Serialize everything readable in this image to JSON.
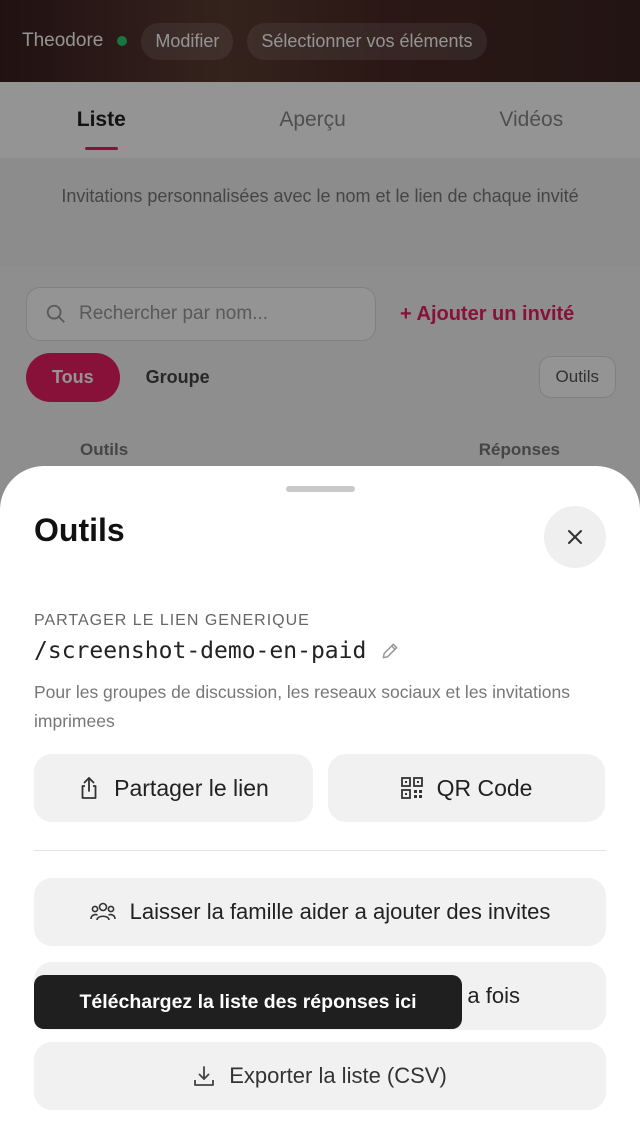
{
  "background": {
    "header": {
      "name": "Theodore",
      "edit_label": "Modifier",
      "select_label": "Sélectionner vos éléments"
    },
    "tabs": [
      "Liste",
      "Aperçu",
      "Vidéos"
    ],
    "info_text": "Invitations personnalisées avec le nom et le lien de chaque invité",
    "search_placeholder": "Rechercher par nom...",
    "add_guest_label": "+ Ajouter un invité",
    "filter_all": "Tous",
    "filter_group": "Groupe",
    "tools_label": "Outils",
    "table_headers": [
      "Outils",
      "Réponses"
    ]
  },
  "sheet": {
    "title": "Outils",
    "share_section_label": "PARTAGER LE LIEN GENERIQUE",
    "slug": "/screenshot-demo-en-paid",
    "description": "Pour les groupes de discussion, les reseaux sociaux et les invitations imprimees",
    "share_button": "Partager le lien",
    "qr_button": "QR Code",
    "family_button": "Laisser la famille aider a ajouter des invites",
    "bulk_button_visible_text": "a fois",
    "export_button": "Exporter la liste (CSV)"
  },
  "tooltip": {
    "text": "Téléchargez la liste des réponses ici"
  },
  "colors": {
    "accent": "#e91e63",
    "sheet_bg": "#ffffff",
    "button_bg": "#f1f1f1",
    "tooltip_bg": "#1f1f1f"
  }
}
